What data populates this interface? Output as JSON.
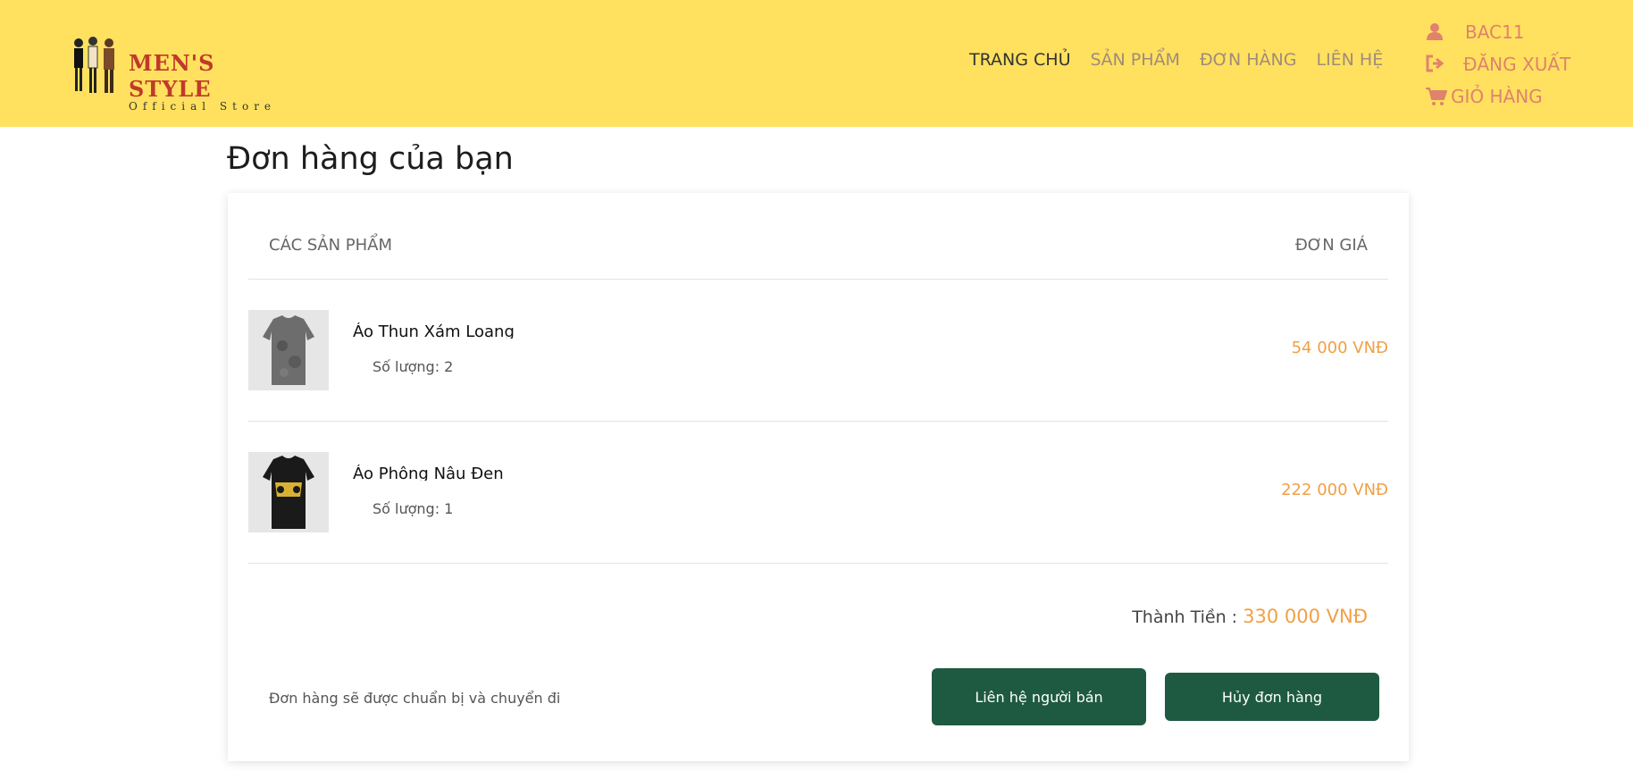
{
  "brand": {
    "title": "MEN'S STYLE",
    "subtitle": "Official Store"
  },
  "nav": [
    {
      "label": "TRANG CHỦ",
      "active": true
    },
    {
      "label": "SẢN PHẨM",
      "active": false
    },
    {
      "label": "ĐƠN HÀNG",
      "active": false
    },
    {
      "label": "LIÊN HỆ",
      "active": false
    }
  ],
  "user_menu": {
    "username": "BAC11",
    "logout_label": "ĐĂNG XUẤT",
    "cart_label": "GIỎ HÀNG",
    "icons": [
      "user-icon",
      "logout-icon",
      "cart-icon"
    ]
  },
  "page": {
    "title": "Đơn hàng của bạn"
  },
  "order": {
    "col_products": "CÁC SẢN PHẨM",
    "col_price": "ĐƠN GIÁ",
    "items": [
      {
        "name": "Áo Thun Xám Loang",
        "qty_text": "Số lượng: 2",
        "price": "54 000 VNĐ"
      },
      {
        "name": "Áo Phông Nâu Đen",
        "qty_text": "Số lượng: 1",
        "price": "222 000 VNĐ"
      }
    ],
    "total_label": "Thành Tiền :",
    "total_value": "330 000 VNĐ",
    "status_note": "Đơn hàng sẽ được chuẩn bị và chuyển đi",
    "contact_button": "Liên hệ người bán",
    "cancel_button": "Hủy đơn hàng"
  },
  "colors": {
    "header_bg": "#ffe15f",
    "accent": "#f0a045",
    "button": "#1e5a42",
    "user_menu": "#e0826d"
  }
}
